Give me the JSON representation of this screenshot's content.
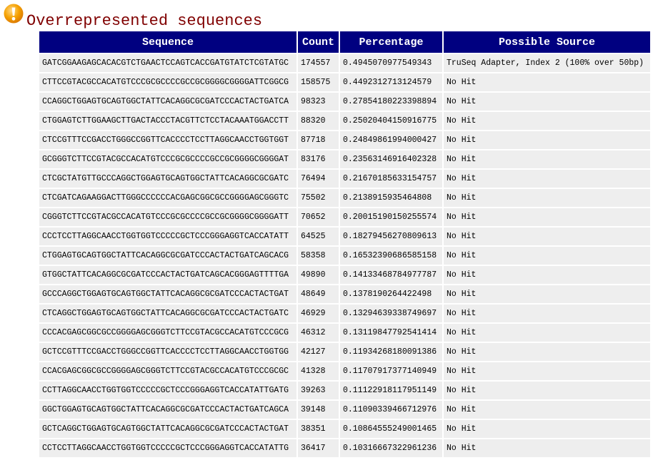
{
  "section": {
    "title": "Overrepresented sequences",
    "status_icon": "warning-icon"
  },
  "colors": {
    "title": "#800000",
    "header_background": "#000080",
    "header_text": "#FFFFFF",
    "cell_background": "#EEEEEE",
    "warning_icon": "#F5A100"
  },
  "table": {
    "headers": [
      "Sequence",
      "Count",
      "Percentage",
      "Possible Source"
    ],
    "rows": [
      {
        "sequence": "GATCGGAAGAGCACACGTCTGAACTCCAGTCACCGATGTATCTCGTATGC",
        "count": "174557",
        "percentage": "0.4945070977549343",
        "source": "TruSeq Adapter, Index 2 (100% over 50bp)"
      },
      {
        "sequence": "CTTCCGTACGCCACATGTCCCGCGCCCCGCCGCGGGGCGGGGATTCGGCG",
        "count": "158575",
        "percentage": "0.4492312713124579",
        "source": "No Hit"
      },
      {
        "sequence": "CCAGGCTGGAGTGCAGTGGCTATTCACAGGCGCGATCCCACTACTGATCA",
        "count": "98323",
        "percentage": "0.27854180223398894",
        "source": "No Hit"
      },
      {
        "sequence": "CTGGAGTCTTGGAAGCTTGACTACCCTACGTTCTCCTACAAATGGACCTT",
        "count": "88320",
        "percentage": "0.25020404150916775",
        "source": "No Hit"
      },
      {
        "sequence": "CTCCGTTTCCGACCTGGGCCGGTTCACCCCTCCTTAGGCAACCTGGTGGT",
        "count": "87718",
        "percentage": "0.24849861994000427",
        "source": "No Hit"
      },
      {
        "sequence": "GCGGGTCTTCCGTACGCCACATGTCCCGCGCCCCGCCGCGGGGCGGGGAT",
        "count": "83176",
        "percentage": "0.23563146916402328",
        "source": "No Hit"
      },
      {
        "sequence": "CTCGCTATGTTGCCCAGGCTGGAGTGCAGTGGCTATTCACAGGCGCGATC",
        "count": "76494",
        "percentage": "0.21670185633154757",
        "source": "No Hit"
      },
      {
        "sequence": "CTCGATCAGAAGGACTTGGGCCCCCCACGAGCGGCGCCGGGGAGCGGGTC",
        "count": "75502",
        "percentage": "0.2138915935464808",
        "source": "No Hit"
      },
      {
        "sequence": "CGGGTCTTCCGTACGCCACATGTCCCGCGCCCCGCCGCGGGGCGGGGATT",
        "count": "70652",
        "percentage": "0.20015190150255574",
        "source": "No Hit"
      },
      {
        "sequence": "CCCTCCTTAGGCAACCTGGTGGTCCCCCGCTCCCGGGAGGTCACCATATT",
        "count": "64525",
        "percentage": "0.18279456270809613",
        "source": "No Hit"
      },
      {
        "sequence": "CTGGAGTGCAGTGGCTATTCACAGGCGCGATCCCACTACTGATCAGCACG",
        "count": "58358",
        "percentage": "0.16532390686585158",
        "source": "No Hit"
      },
      {
        "sequence": "GTGGCTATTCACAGGCGCGATCCCACTACTGATCAGCACGGGAGTTTTGA",
        "count": "49890",
        "percentage": "0.14133468784977787",
        "source": "No Hit"
      },
      {
        "sequence": "GCCCAGGCTGGAGTGCAGTGGCTATTCACAGGCGCGATCCCACTACTGAT",
        "count": "48649",
        "percentage": "0.1378190264422498",
        "source": "No Hit"
      },
      {
        "sequence": "CTCAGGCTGGAGTGCAGTGGCTATTCACAGGCGCGATCCCACTACTGATC",
        "count": "46929",
        "percentage": "0.13294639338749697",
        "source": "No Hit"
      },
      {
        "sequence": "CCCACGAGCGGCGCCGGGGAGCGGGTCTTCCGTACGCCACATGTCCCGCG",
        "count": "46312",
        "percentage": "0.13119847792541414",
        "source": "No Hit"
      },
      {
        "sequence": "GCTCCGTTTCCGACCTGGGCCGGTTCACCCCTCCTTAGGCAACCTGGTGG",
        "count": "42127",
        "percentage": "0.11934268180091386",
        "source": "No Hit"
      },
      {
        "sequence": "CCACGAGCGGCGCCGGGGAGCGGGTCTTCCGTACGCCACATGTCCCGCGC",
        "count": "41328",
        "percentage": "0.11707917377140949",
        "source": "No Hit"
      },
      {
        "sequence": "CCTTAGGCAACCTGGTGGTCCCCCGCTCCCGGGAGGTCACCATATTGATG",
        "count": "39263",
        "percentage": "0.11122918117951149",
        "source": "No Hit"
      },
      {
        "sequence": "GGCTGGAGTGCAGTGGCTATTCACAGGCGCGATCCCACTACTGATCAGCA",
        "count": "39148",
        "percentage": "0.11090339466712976",
        "source": "No Hit"
      },
      {
        "sequence": "GCTCAGGCTGGAGTGCAGTGGCTATTCACAGGCGCGATCCCACTACTGAT",
        "count": "38351",
        "percentage": "0.10864555249001465",
        "source": "No Hit"
      },
      {
        "sequence": "CCTCCTTAGGCAACCTGGTGGTCCCCCGCTCCCGGGAGGTCACCATATTG",
        "count": "36417",
        "percentage": "0.10316667322961236",
        "source": "No Hit"
      }
    ]
  }
}
